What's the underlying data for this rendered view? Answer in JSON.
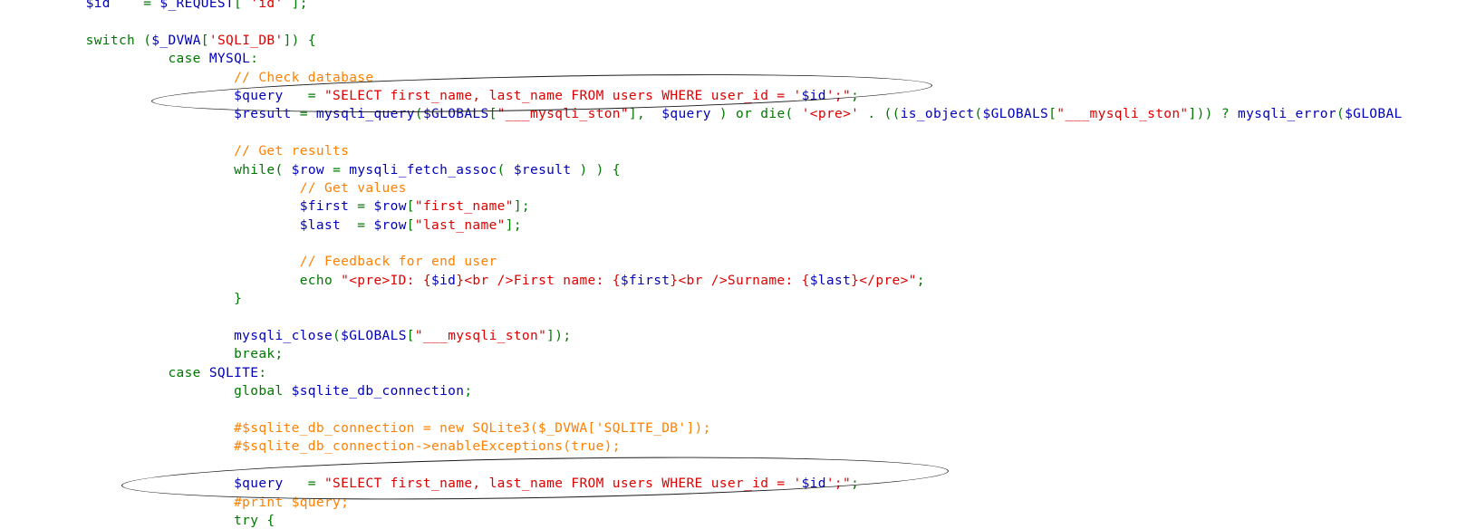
{
  "view": {
    "kind": "source-code-viewer",
    "language": "PHP",
    "background_color": "#FFFFFF",
    "annotation_color": "#1A1A1A",
    "annotation_shape": "ellipse",
    "annotation_count": 2
  },
  "palette": {
    "keyword": "#007700",
    "variable": "#0000BB",
    "string": "#DD0000",
    "comment": "#FF8000",
    "default": "#000000"
  },
  "annotations": [
    {
      "name": "highlighted-mysql-query-line",
      "target_text": "$query  = \"SELECT first_name, last_name FROM users WHERE user_id = '$id';\";"
    },
    {
      "name": "highlighted-sqlite-query-line",
      "target_text": "$query  = \"SELECT first_name, last_name FROM users WHERE user_id = '$id';\";"
    }
  ],
  "code": {
    "lines": [
      {
        "id": "l01",
        "tokens": [
          {
            "t": "$id",
            "c": "var"
          },
          {
            "t": "    = ",
            "c": "kw"
          },
          {
            "t": "$_REQUEST",
            "c": "var"
          },
          {
            "t": "[ ",
            "c": "kw"
          },
          {
            "t": "'id'",
            "c": "str"
          },
          {
            "t": " ];",
            "c": "kw"
          }
        ],
        "indent": 4
      },
      {
        "id": "l02",
        "tokens": [],
        "indent": 0
      },
      {
        "id": "l03",
        "tokens": [
          {
            "t": "switch ",
            "c": "kw"
          },
          {
            "t": "(",
            "c": "kw"
          },
          {
            "t": "$_DVWA",
            "c": "var"
          },
          {
            "t": "[",
            "c": "kw"
          },
          {
            "t": "'SQLI_DB'",
            "c": "str"
          },
          {
            "t": "]) {",
            "c": "kw"
          }
        ],
        "indent": 4
      },
      {
        "id": "l04",
        "tokens": [
          {
            "t": "case ",
            "c": "kw"
          },
          {
            "t": "MYSQL",
            "c": "var"
          },
          {
            "t": ":",
            "c": "kw"
          }
        ],
        "indent": 9
      },
      {
        "id": "l05",
        "tokens": [
          {
            "t": "// Check database",
            "c": "cmt"
          }
        ],
        "indent": 13
      },
      {
        "id": "l06",
        "tokens": [
          {
            "t": "$query",
            "c": "var"
          },
          {
            "t": "   = ",
            "c": "kw"
          },
          {
            "t": "\"SELECT first_name, last_name FROM users WHERE user_id = '",
            "c": "str"
          },
          {
            "t": "$id",
            "c": "var"
          },
          {
            "t": "';\"",
            "c": "str"
          },
          {
            "t": ";",
            "c": "kw"
          }
        ],
        "indent": 13
      },
      {
        "id": "l07",
        "tokens": [
          {
            "t": "$result",
            "c": "var"
          },
          {
            "t": " = ",
            "c": "kw"
          },
          {
            "t": "mysqli_query",
            "c": "var"
          },
          {
            "t": "(",
            "c": "kw"
          },
          {
            "t": "$GLOBALS",
            "c": "var"
          },
          {
            "t": "[",
            "c": "kw"
          },
          {
            "t": "\"___mysqli_ston\"",
            "c": "str"
          },
          {
            "t": "],  ",
            "c": "kw"
          },
          {
            "t": "$query",
            "c": "var"
          },
          {
            "t": " ) ",
            "c": "kw"
          },
          {
            "t": "or ",
            "c": "kw"
          },
          {
            "t": "die",
            "c": "kw"
          },
          {
            "t": "( ",
            "c": "kw"
          },
          {
            "t": "'<pre>'",
            "c": "str"
          },
          {
            "t": " . ",
            "c": "kw"
          },
          {
            "t": "((",
            "c": "kw"
          },
          {
            "t": "is_object",
            "c": "var"
          },
          {
            "t": "(",
            "c": "kw"
          },
          {
            "t": "$GLOBALS",
            "c": "var"
          },
          {
            "t": "[",
            "c": "kw"
          },
          {
            "t": "\"___mysqli_ston\"",
            "c": "str"
          },
          {
            "t": "])) ? ",
            "c": "kw"
          },
          {
            "t": "mysqli_error",
            "c": "var"
          },
          {
            "t": "(",
            "c": "kw"
          },
          {
            "t": "$GLOBAL",
            "c": "var"
          }
        ],
        "indent": 13,
        "clipped_right": true
      },
      {
        "id": "l08",
        "tokens": [],
        "indent": 0
      },
      {
        "id": "l09",
        "tokens": [
          {
            "t": "// Get results",
            "c": "cmt"
          }
        ],
        "indent": 13
      },
      {
        "id": "l10",
        "tokens": [
          {
            "t": "while",
            "c": "kw"
          },
          {
            "t": "( ",
            "c": "kw"
          },
          {
            "t": "$row",
            "c": "var"
          },
          {
            "t": " = ",
            "c": "kw"
          },
          {
            "t": "mysqli_fetch_assoc",
            "c": "var"
          },
          {
            "t": "( ",
            "c": "kw"
          },
          {
            "t": "$result",
            "c": "var"
          },
          {
            "t": " ) ) {",
            "c": "kw"
          }
        ],
        "indent": 13
      },
      {
        "id": "l11",
        "tokens": [
          {
            "t": "// Get values",
            "c": "cmt"
          }
        ],
        "indent": 17
      },
      {
        "id": "l12",
        "tokens": [
          {
            "t": "$first",
            "c": "var"
          },
          {
            "t": " = ",
            "c": "kw"
          },
          {
            "t": "$row",
            "c": "var"
          },
          {
            "t": "[",
            "c": "kw"
          },
          {
            "t": "\"first_name\"",
            "c": "str"
          },
          {
            "t": "];",
            "c": "kw"
          }
        ],
        "indent": 17
      },
      {
        "id": "l13",
        "tokens": [
          {
            "t": "$last",
            "c": "var"
          },
          {
            "t": "  = ",
            "c": "kw"
          },
          {
            "t": "$row",
            "c": "var"
          },
          {
            "t": "[",
            "c": "kw"
          },
          {
            "t": "\"last_name\"",
            "c": "str"
          },
          {
            "t": "];",
            "c": "kw"
          }
        ],
        "indent": 17
      },
      {
        "id": "l14",
        "tokens": [],
        "indent": 0
      },
      {
        "id": "l15",
        "tokens": [
          {
            "t": "// Feedback for end user",
            "c": "cmt"
          }
        ],
        "indent": 17
      },
      {
        "id": "l16",
        "tokens": [
          {
            "t": "echo ",
            "c": "kw"
          },
          {
            "t": "\"<pre>ID: {",
            "c": "str"
          },
          {
            "t": "$id",
            "c": "var"
          },
          {
            "t": "}<br />First name: {",
            "c": "str"
          },
          {
            "t": "$first",
            "c": "var"
          },
          {
            "t": "}<br />Surname: {",
            "c": "str"
          },
          {
            "t": "$last",
            "c": "var"
          },
          {
            "t": "}</pre>\"",
            "c": "str"
          },
          {
            "t": ";",
            "c": "kw"
          }
        ],
        "indent": 17
      },
      {
        "id": "l17",
        "tokens": [
          {
            "t": "}",
            "c": "kw"
          }
        ],
        "indent": 13
      },
      {
        "id": "l18",
        "tokens": [],
        "indent": 0
      },
      {
        "id": "l19",
        "tokens": [
          {
            "t": "mysqli_close",
            "c": "var"
          },
          {
            "t": "(",
            "c": "kw"
          },
          {
            "t": "$GLOBALS",
            "c": "var"
          },
          {
            "t": "[",
            "c": "kw"
          },
          {
            "t": "\"___mysqli_ston\"",
            "c": "str"
          },
          {
            "t": "]);",
            "c": "kw"
          }
        ],
        "indent": 13
      },
      {
        "id": "l20",
        "tokens": [
          {
            "t": "break",
            "c": "kw"
          },
          {
            "t": ";",
            "c": "kw"
          }
        ],
        "indent": 13
      },
      {
        "id": "l21",
        "tokens": [
          {
            "t": "case ",
            "c": "kw"
          },
          {
            "t": "SQLITE",
            "c": "var"
          },
          {
            "t": ":",
            "c": "kw"
          }
        ],
        "indent": 9
      },
      {
        "id": "l22",
        "tokens": [
          {
            "t": "global ",
            "c": "kw"
          },
          {
            "t": "$sqlite_db_connection",
            "c": "var"
          },
          {
            "t": ";",
            "c": "kw"
          }
        ],
        "indent": 13
      },
      {
        "id": "l23",
        "tokens": [],
        "indent": 0
      },
      {
        "id": "l24",
        "tokens": [
          {
            "t": "#$sqlite_db_connection = new SQLite3($_DVWA['SQLITE_DB']);",
            "c": "cmt"
          }
        ],
        "indent": 13
      },
      {
        "id": "l25",
        "tokens": [
          {
            "t": "#$sqlite_db_connection->enableExceptions(true);",
            "c": "cmt"
          }
        ],
        "indent": 13
      },
      {
        "id": "l26",
        "tokens": [],
        "indent": 0
      },
      {
        "id": "l27",
        "tokens": [
          {
            "t": "$query",
            "c": "var"
          },
          {
            "t": "   = ",
            "c": "kw"
          },
          {
            "t": "\"SELECT first_name, last_name FROM users WHERE user_id = '",
            "c": "str"
          },
          {
            "t": "$id",
            "c": "var"
          },
          {
            "t": "';\"",
            "c": "str"
          },
          {
            "t": ";",
            "c": "kw"
          }
        ],
        "indent": 13
      },
      {
        "id": "l28",
        "tokens": [
          {
            "t": "#print $query;",
            "c": "cmt"
          }
        ],
        "indent": 13
      },
      {
        "id": "l29",
        "tokens": [
          {
            "t": "try {",
            "c": "kw"
          }
        ],
        "indent": 13
      }
    ]
  }
}
